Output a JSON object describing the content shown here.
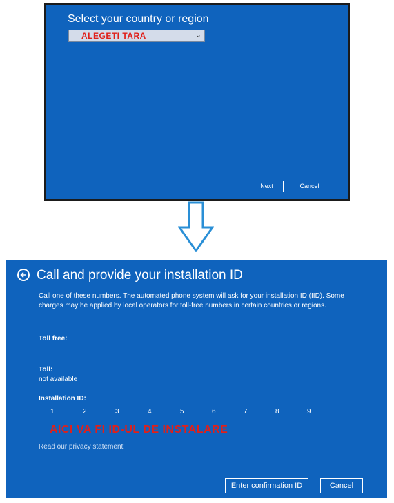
{
  "region_dialog": {
    "title": "Select your country or region",
    "selected_region": "ALEGETI TARA",
    "next_label": "Next",
    "cancel_label": "Cancel"
  },
  "arrow": {
    "icon": "down-arrow-icon",
    "color": "#2a8fd6"
  },
  "call_dialog": {
    "title": "Call and provide your installation ID",
    "description": "Call one of these numbers. The automated phone system will ask for your installation ID (IID). Some charges may be applied by local operators for toll-free numbers in certain countries or regions.",
    "toll_free_label": "Toll free:",
    "toll_label": "Toll:",
    "toll_value": "not available",
    "installation_id_label": "Installation ID:",
    "groups": [
      "1",
      "2",
      "3",
      "4",
      "5",
      "6",
      "7",
      "8",
      "9"
    ],
    "installation_id_placeholder": "AICI VA FI ID-UL DE INSTALARE",
    "privacy_link": "Read our privacy statement",
    "confirm_label": "Enter confirmation ID",
    "cancel_label": "Cancel"
  },
  "colors": {
    "dialog_background": "#0f63bd",
    "highlight_text": "#e0201a"
  }
}
